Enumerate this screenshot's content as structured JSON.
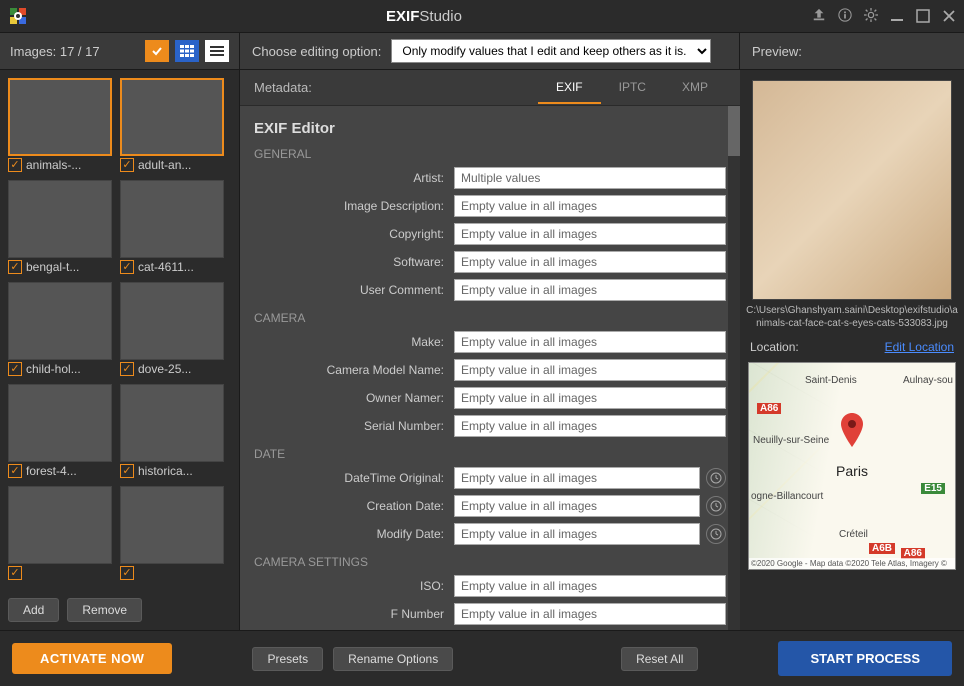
{
  "app": {
    "title_bold": "EXIF",
    "title_light": "Studio"
  },
  "toolbar": {
    "images_label": "Images: 17 / 17",
    "choose_label": "Choose editing option:",
    "choose_value": "Only modify values that I edit and keep others as it is.",
    "preview_label": "Preview:"
  },
  "thumbs": [
    {
      "label": "animals-...",
      "cls": "cat-img",
      "sel": true
    },
    {
      "label": "adult-an...",
      "cls": "people-img",
      "sel": true
    },
    {
      "label": "bengal-t...",
      "cls": "tiger-img",
      "sel": false
    },
    {
      "label": "cat-4611...",
      "cls": "cat-img",
      "sel": false
    },
    {
      "label": "child-hol...",
      "cls": "people-img",
      "sel": false
    },
    {
      "label": "dove-25...",
      "cls": "bird-img",
      "sel": false
    },
    {
      "label": "forest-4...",
      "cls": "forest-img",
      "sel": false
    },
    {
      "label": "historica...",
      "cls": "tower-img",
      "sel": false
    },
    {
      "label": "",
      "cls": "knob-img",
      "sel": false
    },
    {
      "label": "",
      "cls": "train-img",
      "sel": false
    }
  ],
  "sidebar_btns": {
    "add": "Add",
    "remove": "Remove"
  },
  "meta": {
    "label": "Metadata:",
    "tabs": {
      "exif": "EXIF",
      "iptc": "IPTC",
      "xmp": "XMP"
    },
    "editor_title": "EXIF Editor",
    "sections": {
      "general": "GENERAL",
      "camera": "CAMERA",
      "date": "DATE",
      "settings": "CAMERA SETTINGS"
    },
    "fields": {
      "artist": {
        "label": "Artist:",
        "value": "Multiple values"
      },
      "desc": {
        "label": "Image Description:",
        "value": "Empty value in all images"
      },
      "copyright": {
        "label": "Copyright:",
        "value": "Empty value in all images"
      },
      "software": {
        "label": "Software:",
        "value": "Empty value in all images"
      },
      "ucomment": {
        "label": "User Comment:",
        "value": "Empty value in all images"
      },
      "make": {
        "label": "Make:",
        "value": "Empty value in all images"
      },
      "model": {
        "label": "Camera Model Name:",
        "value": "Empty value in all images"
      },
      "owner": {
        "label": "Owner Namer:",
        "value": "Empty value in all images"
      },
      "serial": {
        "label": "Serial Number:",
        "value": "Empty value in all images"
      },
      "dto": {
        "label": "DateTime Original:",
        "value": "Empty value in all images"
      },
      "created": {
        "label": "Creation Date:",
        "value": "Empty value in all images"
      },
      "modified": {
        "label": "Modify Date:",
        "value": "Empty value in all images"
      },
      "iso": {
        "label": "ISO:",
        "value": "Empty value in all images"
      },
      "fnum": {
        "label": "F Number",
        "value": "Empty value in all images"
      }
    }
  },
  "preview": {
    "path": "C:\\Users\\Ghanshyam.saini\\Desktop\\exifstudio\\animals-cat-face-cat-s-eyes-cats-533083.jpg",
    "location_label": "Location:",
    "edit_location": "Edit Location",
    "map": {
      "city": "Paris",
      "places": [
        "Saint-Denis",
        "Aulnay-sou",
        "Neuilly-sur-Seine",
        "ogne-Billancourt",
        "Créteil"
      ],
      "roads": [
        "A86",
        "E15",
        "A6B",
        "A86"
      ],
      "attr": "©2020 Google - Map data ©2020 Tele Atlas, Imagery ©"
    }
  },
  "bottom": {
    "activate": "ACTIVATE NOW",
    "presets": "Presets",
    "rename": "Rename Options",
    "reset": "Reset All",
    "start": "START PROCESS"
  }
}
